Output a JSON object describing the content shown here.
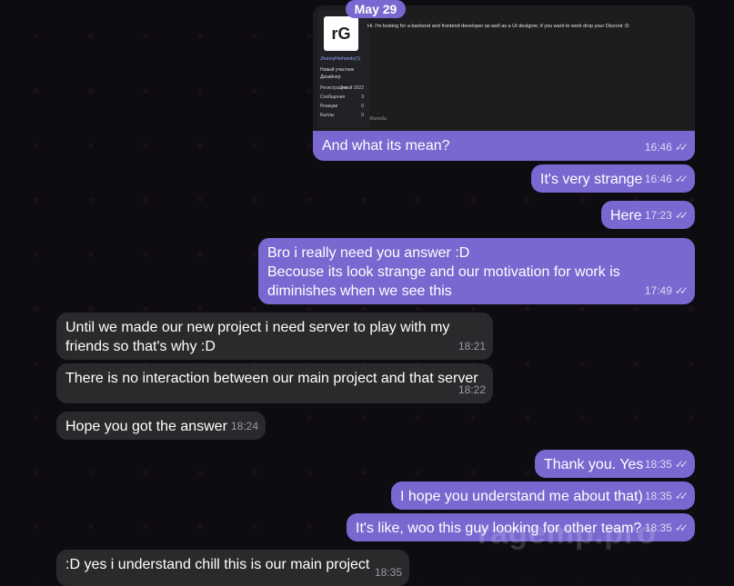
{
  "date_label": "May 29",
  "embedded_post": {
    "quote_date": "12:23 11:16",
    "username": "JhonnyHerhendo(1)",
    "role": "Новый участник",
    "sub_role": "Дизайнер",
    "stats": [
      {
        "label": "Регистрация",
        "value": "9 май 2022"
      },
      {
        "label": "Сообщения",
        "value": "3"
      },
      {
        "label": "Реакции",
        "value": "0"
      },
      {
        "label": "Баллы",
        "value": "0"
      }
    ],
    "text": "Hi. I'm looking for a backend and frontend developer as well as a UI designer, if you want to work drop your Discord :D",
    "footer": "Жалоба"
  },
  "messages": [
    {
      "text": "And what its mean?",
      "time": "16:46",
      "direction": "out"
    },
    {
      "text": "It's very strange",
      "time": "16:46",
      "direction": "out"
    },
    {
      "text": "Here",
      "time": "17:23",
      "direction": "out"
    },
    {
      "text_lines": [
        "Bro i really need you answer :D",
        "Becouse its look strange and our motivation for work is",
        "diminishes when we see this"
      ],
      "time": "17:49",
      "direction": "out"
    },
    {
      "text_lines": [
        "Until we made our new project i need server to play with my",
        "friends so that's why :D"
      ],
      "time": "18:21",
      "direction": "in"
    },
    {
      "text": "There is no interaction between our main project and that server",
      "time": "18:22",
      "direction": "in"
    },
    {
      "text": "Hope you got the answer",
      "time": "18:24",
      "direction": "in"
    },
    {
      "text": "Thank you. Yes",
      "time": "18:35",
      "direction": "out"
    },
    {
      "text": "I hope you understand me about that)",
      "time": "18:35",
      "direction": "out"
    },
    {
      "text": "It's like, woo this guy looking for other team?",
      "time": "18:35",
      "direction": "out"
    },
    {
      "text": ":D yes i understand chill this is our main project",
      "time": "18:35",
      "direction": "in"
    }
  ],
  "watermark": "ragemp.pro",
  "colors": {
    "outgoing": "#7a67d0",
    "incoming": "#2a2a2d",
    "background": "#0e0c10"
  }
}
